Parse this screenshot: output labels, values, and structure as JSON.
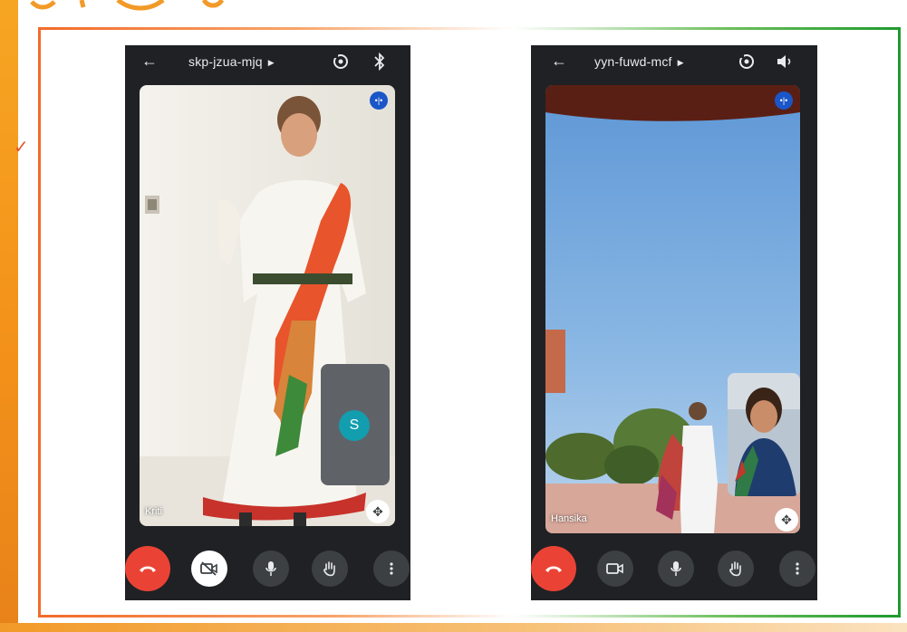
{
  "left_meeting": {
    "meeting_code": "skp-jzua-mjq",
    "participant_name": "Kriti",
    "pip_avatar_letter": "S"
  },
  "right_meeting": {
    "meeting_code": "yyn-fuwd-mcf",
    "participant_name": "Hansika"
  },
  "colors": {
    "saffron": "#f26b2a",
    "green": "#1e9a2e",
    "hangup_red": "#ea4335",
    "meet_dark": "#202124",
    "avatar_teal": "#129eaf"
  },
  "icons": {
    "back": "arrow-left-icon",
    "switch_camera": "switch-camera-icon",
    "bluetooth": "bluetooth-icon",
    "speaker": "speaker-icon",
    "hangup": "phone-hangup-icon",
    "camera_off": "camera-off-icon",
    "camera": "camera-icon",
    "mic": "mic-icon",
    "raise_hand": "hand-icon",
    "more": "more-vertical-icon"
  }
}
